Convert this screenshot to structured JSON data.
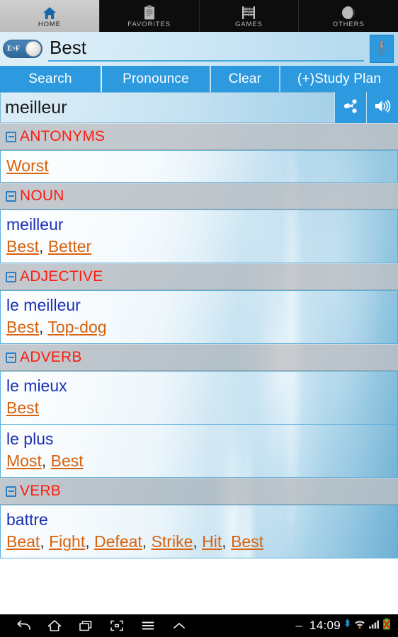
{
  "tabs": [
    {
      "label": "HOME",
      "icon": "home-icon",
      "active": true
    },
    {
      "label": "FAVORITES",
      "icon": "clipboard-icon",
      "active": false
    },
    {
      "label": "GAMES",
      "icon": "abacus-icon",
      "active": false
    },
    {
      "label": "OTHERS",
      "icon": "pie-circle-icon",
      "active": false
    }
  ],
  "search": {
    "direction_toggle": "E>F",
    "value": "Best",
    "placeholder": "",
    "mic_icon": "microphone-icon"
  },
  "actions": {
    "search": "Search",
    "pronounce": "Pronounce",
    "clear": "Clear",
    "study_plan": "(+)Study Plan"
  },
  "result": {
    "word": "meilleur",
    "share_icon": "share-icon",
    "speaker_icon": "speaker-icon"
  },
  "sections": [
    {
      "title": "ANTONYMS",
      "collapse_icon": "minus-box-icon",
      "entries": [
        {
          "french": "",
          "english": [
            "Worst"
          ]
        }
      ]
    },
    {
      "title": "NOUN",
      "collapse_icon": "minus-box-icon",
      "entries": [
        {
          "french": "meilleur",
          "english": [
            "Best",
            "Better"
          ]
        }
      ]
    },
    {
      "title": "ADJECTIVE",
      "collapse_icon": "minus-box-icon",
      "entries": [
        {
          "french": "le meilleur",
          "english": [
            "Best",
            "Top-dog"
          ]
        }
      ]
    },
    {
      "title": "ADVERB",
      "collapse_icon": "minus-box-icon",
      "entries": [
        {
          "french": "le mieux",
          "english": [
            "Best"
          ]
        },
        {
          "french": "le plus",
          "english": [
            "Most",
            "Best"
          ]
        }
      ]
    },
    {
      "title": "VERB",
      "collapse_icon": "minus-box-icon",
      "entries": [
        {
          "french": "battre",
          "english": [
            "Beat",
            "Fight",
            "Defeat",
            "Strike",
            "Hit",
            "Best"
          ]
        }
      ]
    }
  ],
  "navbar": {
    "buttons": [
      {
        "name": "back-icon"
      },
      {
        "name": "home-icon"
      },
      {
        "name": "recents-icon"
      },
      {
        "name": "screenshot-icon"
      },
      {
        "name": "menu-icon"
      },
      {
        "name": "chevron-up-icon"
      }
    ],
    "dash": "–",
    "time": "14:09",
    "status_icons": [
      "bluetooth-icon",
      "wifi-icon",
      "signal-icon",
      "battery-icon"
    ]
  },
  "colors": {
    "accent_blue": "#2d9ae0",
    "section_title_red": "#ff1b0e",
    "french_blue": "#1a2fb5",
    "english_orange": "#d8620d"
  }
}
